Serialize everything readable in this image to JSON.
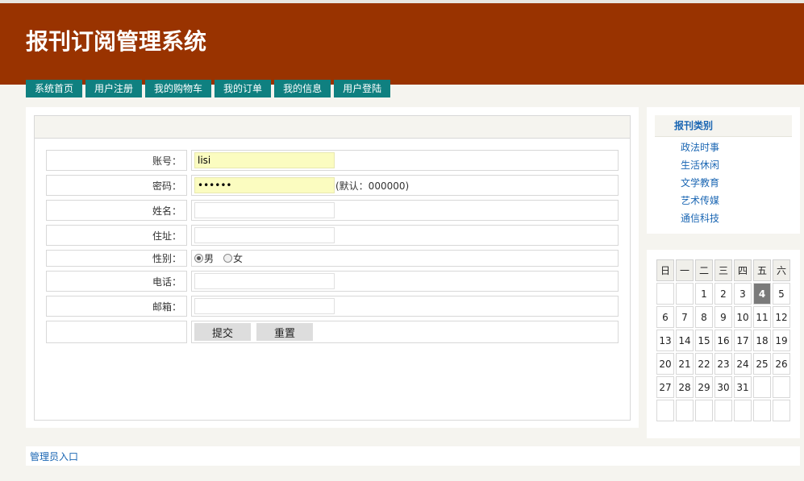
{
  "site": {
    "title": "报刊订阅管理系统"
  },
  "nav": [
    "系统首页",
    "用户注册",
    "我的购物车",
    "我的订单",
    "我的信息",
    "用户登陆"
  ],
  "form": {
    "account_label": "账号：",
    "account_value": "lisi",
    "password_label": "密码：",
    "password_value": "000000",
    "password_hint": "(默认：000000)",
    "name_label": "姓名：",
    "address_label": "住址：",
    "gender_label": "性别：",
    "gender_male": "男",
    "gender_female": "女",
    "phone_label": "电话：",
    "email_label": "邮箱：",
    "submit": "提交",
    "reset": "重置"
  },
  "categories": {
    "title": "报刊类别",
    "items": [
      "政法时事",
      "生活休闲",
      "文学教育",
      "艺术传媒",
      "通信科技"
    ]
  },
  "calendar": {
    "weekdays": [
      "日",
      "一",
      "二",
      "三",
      "四",
      "五",
      "六"
    ],
    "weeks": [
      [
        "",
        "",
        "1",
        "2",
        "3",
        "4",
        "5"
      ],
      [
        "6",
        "7",
        "8",
        "9",
        "10",
        "11",
        "12"
      ],
      [
        "13",
        "14",
        "15",
        "16",
        "17",
        "18",
        "19"
      ],
      [
        "20",
        "21",
        "22",
        "23",
        "24",
        "25",
        "26"
      ],
      [
        "27",
        "28",
        "29",
        "30",
        "31",
        "",
        ""
      ],
      [
        "",
        "",
        "",
        "",
        "",
        "",
        ""
      ]
    ],
    "today": "4"
  },
  "footer": {
    "admin_link": "管理员入口"
  },
  "colors": {
    "header": "#993300",
    "nav": "#0f8080",
    "link": "#1a66b3"
  }
}
